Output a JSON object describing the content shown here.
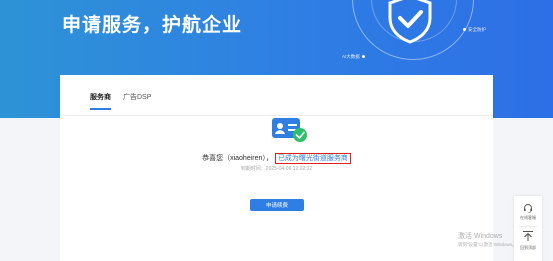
{
  "hero": {
    "title": "申请服务，护航企业",
    "tag_right": "安全防护",
    "tag_left": "AI大数据"
  },
  "tabs": [
    {
      "label": "服务商",
      "active": true
    },
    {
      "label": "广告DSP",
      "active": false
    }
  ],
  "result": {
    "message": "恭喜您（xiaoheiren），",
    "highlight": "已成为曙光街道服务商",
    "expire_time": "到期时间：2025-04-06 12:02:32"
  },
  "renew_button": "申请续费",
  "float_tools": {
    "service_label": "在线客服",
    "top_label": "回到顶部"
  },
  "watermark": {
    "line1": "激活 Windows",
    "line2": "转到“设置”以激活 Windows。"
  },
  "colors": {
    "accent": "#2f7ee4",
    "success": "#2dbf6a",
    "highlight_border": "#e02020"
  }
}
